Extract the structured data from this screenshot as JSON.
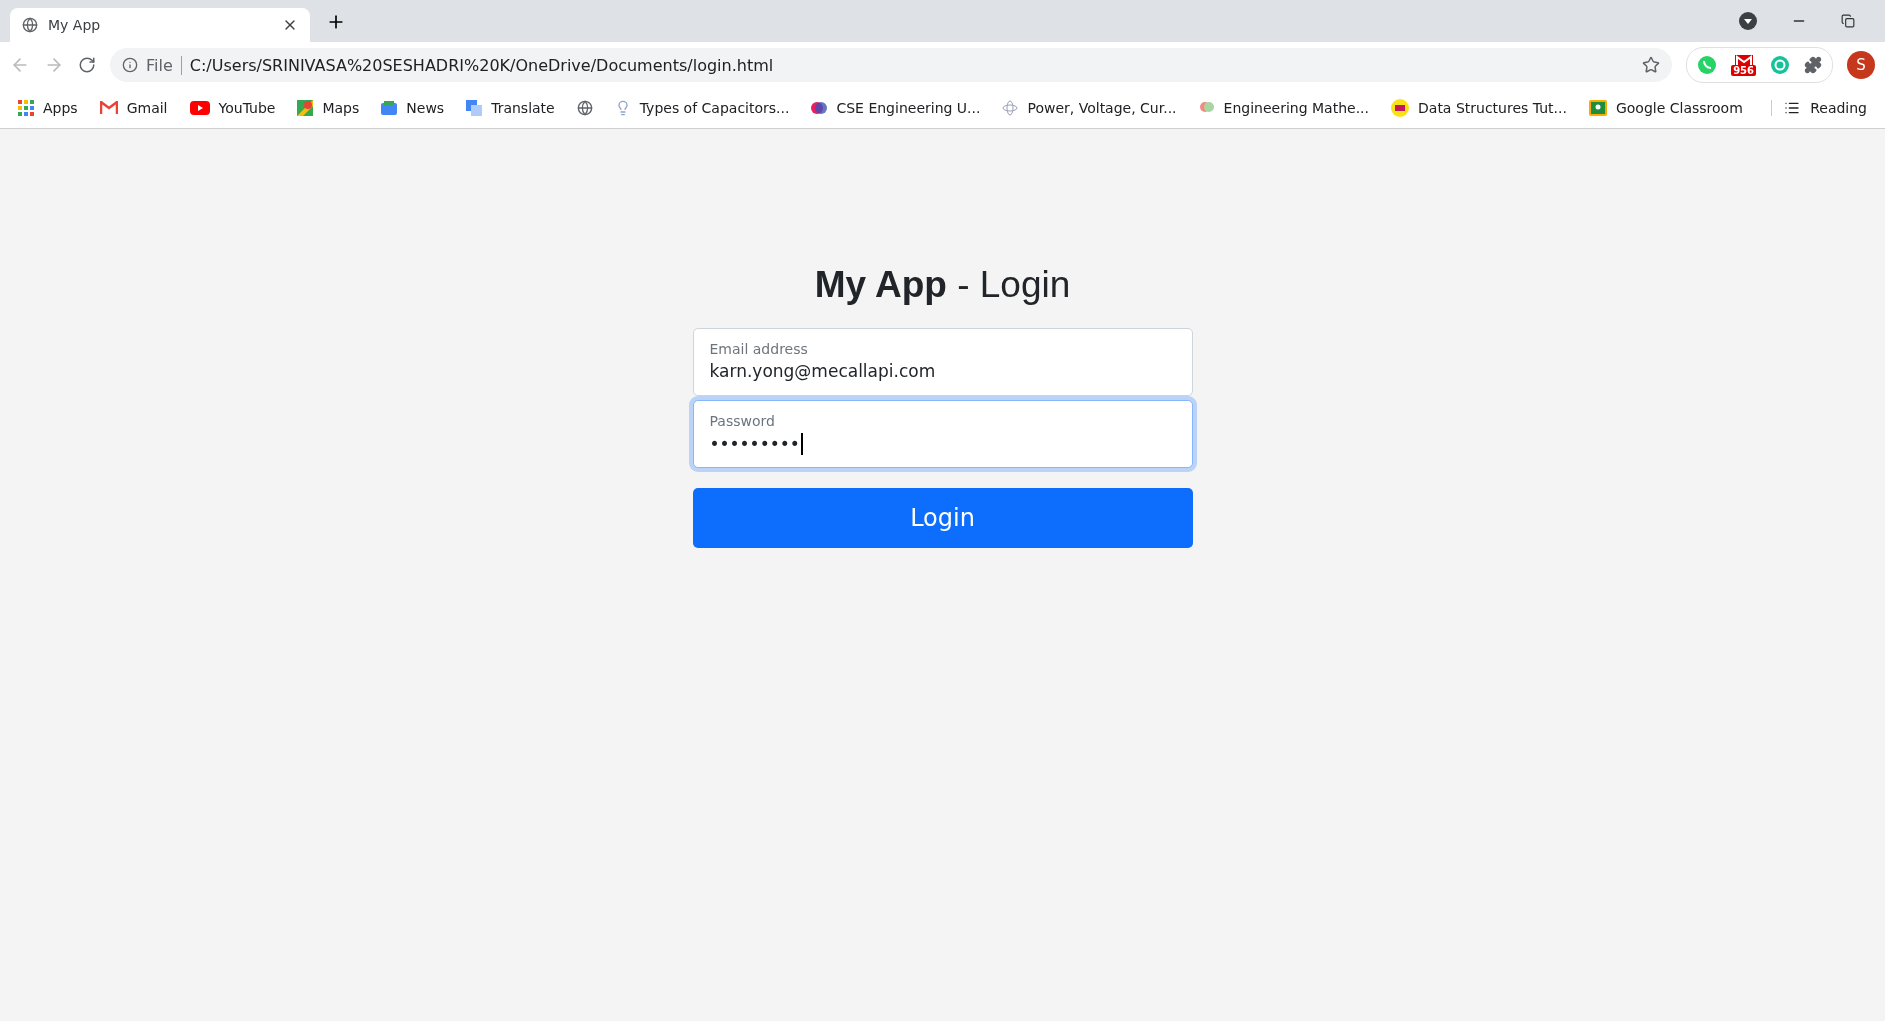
{
  "browser": {
    "tab": {
      "title": "My App",
      "selected": true
    },
    "address": {
      "scheme": "File",
      "url": "C:/Users/SRINIVASA%20SESHADRI%20K/OneDrive/Documents/login.html"
    },
    "bookmarks": [
      {
        "kind": "labeled",
        "label": "Apps"
      },
      {
        "kind": "labeled",
        "label": "Gmail"
      },
      {
        "kind": "labeled",
        "label": "YouTube"
      },
      {
        "kind": "labeled",
        "label": "Maps"
      },
      {
        "kind": "labeled",
        "label": "News"
      },
      {
        "kind": "labeled",
        "label": "Translate"
      },
      {
        "kind": "icon"
      },
      {
        "kind": "labeled",
        "label": "Types of Capacitors..."
      },
      {
        "kind": "labeled",
        "label": "CSE Engineering U..."
      },
      {
        "kind": "labeled",
        "label": "Power, Voltage, Cur..."
      },
      {
        "kind": "labeled",
        "label": "Engineering Mathe..."
      },
      {
        "kind": "labeled",
        "label": "Data Structures Tut..."
      },
      {
        "kind": "labeled",
        "label": "Google Classroom"
      }
    ],
    "reading_list": "Reading",
    "mail_badge": "956",
    "profile": "S"
  },
  "login": {
    "title_bold": "My App",
    "title_rest": "- Login",
    "fields": [
      {
        "label": "Email address",
        "value": "karn.yong@mecallapi.com",
        "focused": false
      },
      {
        "label": "Password",
        "value": "•••••••••",
        "focused": true
      }
    ],
    "button": "Login"
  }
}
